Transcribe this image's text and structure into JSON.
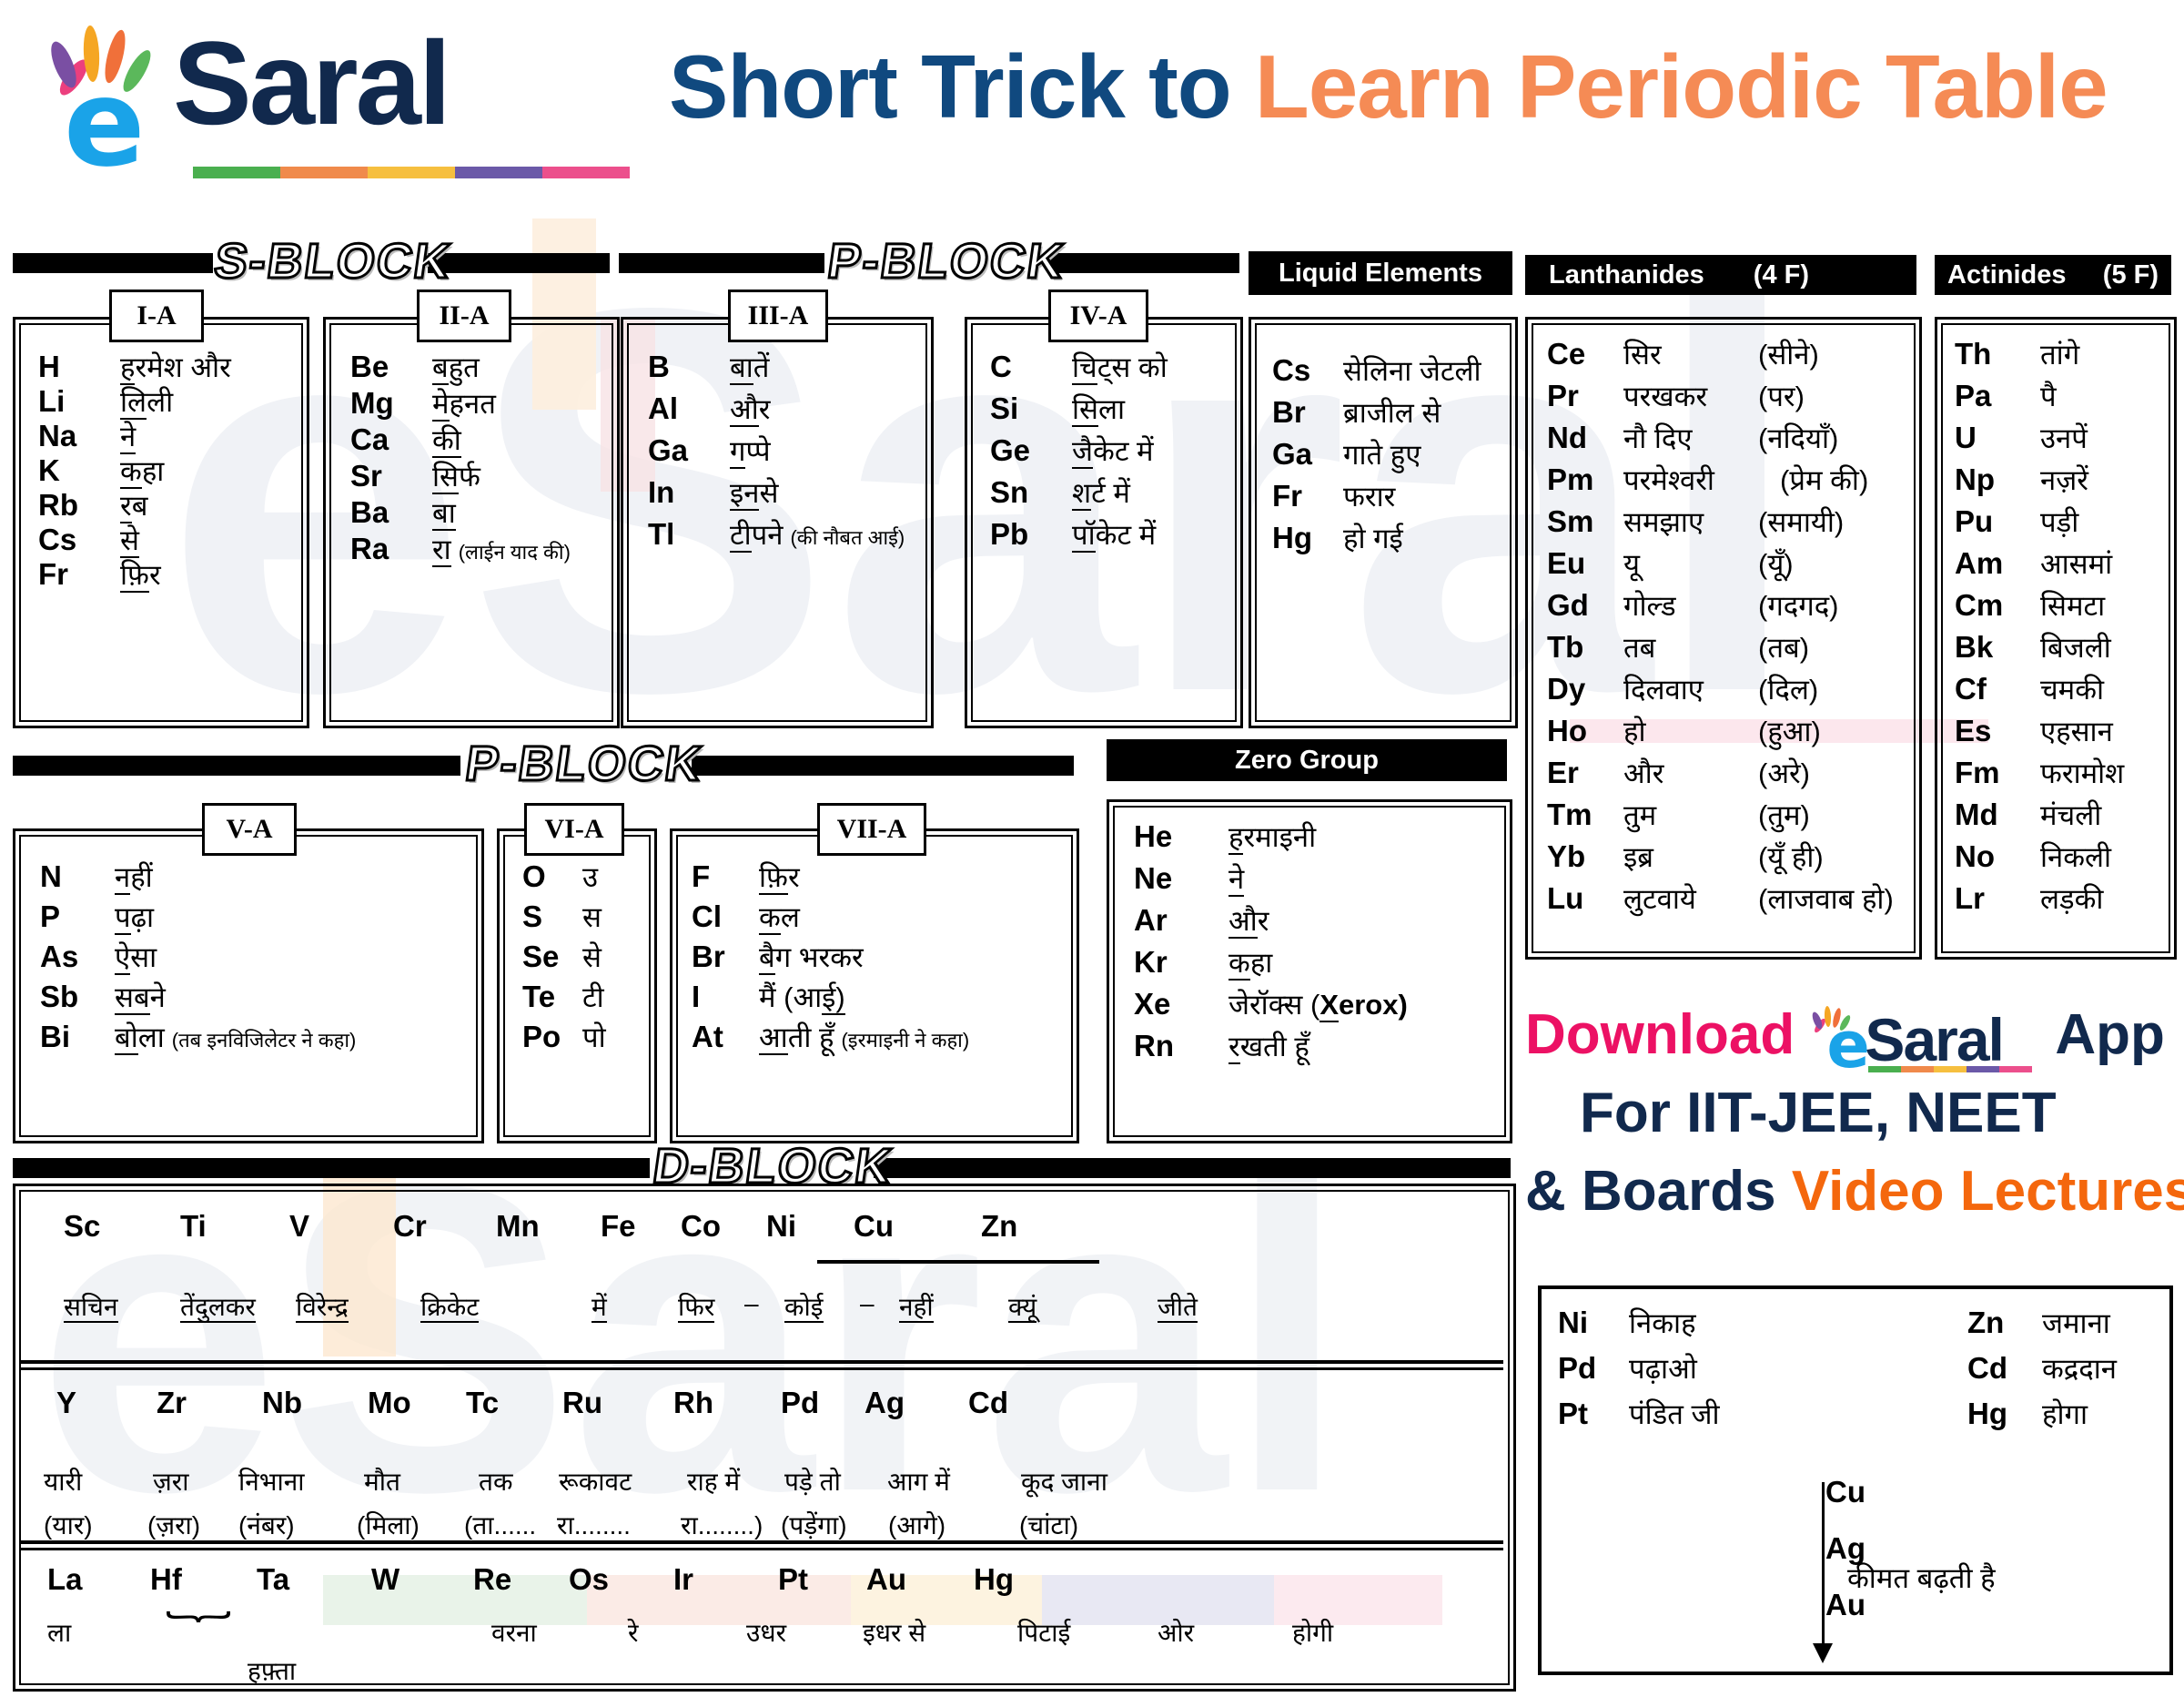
{
  "header": {
    "logo_text": "Saral",
    "logo_e": "e",
    "title_part1": "Short Trick to ",
    "title_part2": "Learn Periodic Table",
    "bar_colors": [
      "#4aaf4f",
      "#f08a4b",
      "#f6bf3f",
      "#6b59a8",
      "#ec4f8c"
    ],
    "hand_colors": [
      "#7a4fa3",
      "#f5a623",
      "#f0703a",
      "#5bb85b",
      "#ec3f7e"
    ],
    "navy": "#11294d",
    "cyan": "#1aa3e8",
    "title_blue": "#10497f",
    "title_orange": "#f58b55"
  },
  "block_labels": {
    "s_block": "S-BLOCK",
    "p_block_1": "P-BLOCK",
    "p_block_2": "P-BLOCK",
    "d_block": "D-BLOCK"
  },
  "groups": [
    {
      "tag": "I-A",
      "rows": [
        {
          "sym": "H",
          "mn": "ह",
          "rest": "रमेश  और"
        },
        {
          "sym": "Li",
          "mn": "लि",
          "rest": "ली"
        },
        {
          "sym": "Na",
          "mn": "ने",
          "rest": ""
        },
        {
          "sym": "K",
          "mn": "क",
          "rest": "हा"
        },
        {
          "sym": "Rb",
          "mn": "र",
          "rest": "ब"
        },
        {
          "sym": "Cs",
          "mn": "से",
          "rest": ""
        },
        {
          "sym": "Fr",
          "mn": "फ़ि",
          "rest": "र"
        }
      ]
    },
    {
      "tag": "II-A",
      "rows": [
        {
          "sym": "Be",
          "mn": "ब",
          "rest": "हुत"
        },
        {
          "sym": "Mg",
          "mn": "मे",
          "rest": "हनत"
        },
        {
          "sym": "Ca",
          "mn": "की",
          "rest": ""
        },
        {
          "sym": "Sr",
          "mn": "सि",
          "rest": "र्फ"
        },
        {
          "sym": "Ba",
          "mn": "बा",
          "rest": ""
        },
        {
          "sym": "Ra",
          "mn": "रा",
          "rest": "",
          "note": "(लाईन याद की)"
        }
      ]
    },
    {
      "tag": "III-A",
      "rows": [
        {
          "sym": "B",
          "mn": "बा",
          "rest": "तें"
        },
        {
          "sym": "Al",
          "mn": "औ",
          "rest": "र"
        },
        {
          "sym": "Ga",
          "mn": "ग",
          "rest": "प्पे"
        },
        {
          "sym": "In",
          "mn": "इन",
          "rest": "से"
        },
        {
          "sym": "Tl",
          "mn": "टी",
          "rest": "पने",
          "note": "(की नौबत आई)"
        }
      ]
    },
    {
      "tag": "IV-A",
      "rows": [
        {
          "sym": "C",
          "mn": "चि",
          "rest": "ट्स  को"
        },
        {
          "sym": "Si",
          "mn": "सि",
          "rest": "ला"
        },
        {
          "sym": "Ge",
          "mn": "जै",
          "rest": "केट  में"
        },
        {
          "sym": "Sn",
          "mn": "श",
          "rest": "र्ट  में"
        },
        {
          "sym": "Pb",
          "mn": "पॉ",
          "rest": "केट  में"
        }
      ]
    },
    {
      "tag": "V-A",
      "rows": [
        {
          "sym": "N",
          "mn": "न",
          "rest": "हीं"
        },
        {
          "sym": "P",
          "mn": "प",
          "rest": "ढ़ा"
        },
        {
          "sym": "As",
          "mn": "ऐ",
          "rest": "सा"
        },
        {
          "sym": "Sb",
          "mn": "सब",
          "rest": "ने"
        },
        {
          "sym": "Bi",
          "mn": "बो",
          "rest": "ला",
          "note": "(तब इनविजिलेटर ने कहा)"
        }
      ]
    },
    {
      "tag": "VI-A",
      "rows": [
        {
          "sym": "O",
          "mn": "उ",
          "rest": ""
        },
        {
          "sym": "S",
          "mn": "स",
          "rest": ""
        },
        {
          "sym": "Se",
          "mn": "से",
          "rest": ""
        },
        {
          "sym": "Te",
          "mn": "टी",
          "rest": ""
        },
        {
          "sym": "Po",
          "mn": "पो",
          "rest": ""
        }
      ]
    },
    {
      "tag": "VII-A",
      "rows": [
        {
          "sym": "F",
          "mn": "फ़ि",
          "rest": "र"
        },
        {
          "sym": "Cl",
          "mn": "क",
          "rest": "ल"
        },
        {
          "sym": "Br",
          "mn": "बै",
          "rest": "ग  भरकर"
        },
        {
          "sym": "I",
          "mn": "मैं  (आ",
          "rest": "ई)"
        },
        {
          "sym": "At",
          "mn": "आ",
          "rest": "ती हूँ",
          "note": "(इरमाइनी ने कहा)"
        }
      ]
    }
  ],
  "liquid_elements": {
    "title": "Liquid Elements",
    "rows": [
      {
        "sym": "Cs",
        "mn": "सेलिना  जेटली"
      },
      {
        "sym": "Br",
        "mn": "ब्राजील  से"
      },
      {
        "sym": "Ga",
        "mn": "गाते  हुए"
      },
      {
        "sym": "Fr",
        "mn": "फरार"
      },
      {
        "sym": "Hg",
        "mn": "हो  गई"
      }
    ]
  },
  "zero_group": {
    "title": "Zero Group",
    "rows": [
      {
        "sym": "He",
        "mn": "ह",
        "rest": "रमाइनी"
      },
      {
        "sym": "Ne",
        "mn": "ने",
        "rest": ""
      },
      {
        "sym": "Ar",
        "mn": "औ",
        "rest": "र"
      },
      {
        "sym": "Kr",
        "mn": "क",
        "rest": "हा"
      },
      {
        "sym": "Xe",
        "mn": "जेरॉक्स (",
        "rest": "Xerox)",
        "bold_tail": true
      },
      {
        "sym": "Rn",
        "mn": "र",
        "rest": "खती  हूँ"
      }
    ]
  },
  "lanthanides": {
    "title": "Lanthanides",
    "sub": "(4 F)",
    "rows": [
      {
        "sym": "Ce",
        "mn": "सिर",
        "par": "(सीने)"
      },
      {
        "sym": "Pr",
        "mn": "परखकर",
        "par": "(पर)"
      },
      {
        "sym": "Nd",
        "mn": "नौ दिए",
        "par": "(नदियाँ)"
      },
      {
        "sym": "Pm",
        "mn": "परमेश्वरी",
        "par": "(प्रेम की)"
      },
      {
        "sym": "Sm",
        "mn": "समझाए",
        "par": "(समायी)"
      },
      {
        "sym": "Eu",
        "mn": "यू",
        "par": "(यूँ)"
      },
      {
        "sym": "Gd",
        "mn": "गोल्ड",
        "par": "(गदगद)"
      },
      {
        "sym": "Tb",
        "mn": "तब",
        "par": "(तब)"
      },
      {
        "sym": "Dy",
        "mn": "दिलवाए",
        "par": "(दिल)"
      },
      {
        "sym": "Ho",
        "mn": "हो",
        "par": "(हुआ)"
      },
      {
        "sym": "Er",
        "mn": "और",
        "par": "(अरे)"
      },
      {
        "sym": "Tm",
        "mn": "तुम",
        "par": "(तुम)"
      },
      {
        "sym": "Yb",
        "mn": "इब्र",
        "par": "(यूँ ही)"
      },
      {
        "sym": "Lu",
        "mn": "लुटवाये",
        "par": "(लाजवाब हो)"
      }
    ]
  },
  "actinides": {
    "title": "Actinides",
    "sub": "(5 F)",
    "rows": [
      {
        "sym": "Th",
        "mn": "तांगे"
      },
      {
        "sym": "Pa",
        "mn": "पै"
      },
      {
        "sym": "U",
        "mn": "उनपें"
      },
      {
        "sym": "Np",
        "mn": "नज़रें"
      },
      {
        "sym": "Pu",
        "mn": "पड़ी"
      },
      {
        "sym": "Am",
        "mn": "आसमां"
      },
      {
        "sym": "Cm",
        "mn": "सिमटा"
      },
      {
        "sym": "Bk",
        "mn": "बिजली"
      },
      {
        "sym": "Cf",
        "mn": "चमकी"
      },
      {
        "sym": "Es",
        "mn": "एहसान"
      },
      {
        "sym": "Fm",
        "mn": "फरामोश"
      },
      {
        "sym": "Md",
        "mn": "मंचली"
      },
      {
        "sym": "No",
        "mn": "निकली"
      },
      {
        "sym": "Lr",
        "mn": "लड़की"
      }
    ]
  },
  "d_block": {
    "row1": {
      "symbols": [
        "Sc",
        "Ti",
        "V",
        "Cr",
        "Mn",
        "Fe",
        "Co",
        "Ni",
        "Cu",
        "Zn"
      ],
      "words": [
        "सचिन",
        "तेंदुलकर",
        "विरेन्द्र",
        "क्रिकेट",
        "में",
        "फिर",
        "–",
        "कोई",
        "–",
        "नहीं",
        "क्यूं",
        "जीते"
      ]
    },
    "row2": {
      "symbols": [
        "Y",
        "Zr",
        "Nb",
        "Mo",
        "Tc",
        "Ru",
        "Rh",
        "Pd",
        "Ag",
        "Cd"
      ],
      "words": [
        "यारी",
        "ज़रा",
        "निभाना",
        "मौत",
        "तक",
        "रूकावट",
        "राह में",
        "पड़े तो",
        "आग में",
        "कूद जाना"
      ],
      "words2": [
        "(यार)",
        "(ज़रा)",
        "(नंबर)",
        "(मिला)",
        "(ता......",
        "रा........",
        "रा........)",
        "(पड़ेंगा)",
        "(आगे)",
        "(चांटा)"
      ]
    },
    "row3": {
      "symbols": [
        "La",
        "Hf",
        "Ta",
        "W",
        "Re",
        "Os",
        "Ir",
        "Pt",
        "Au",
        "Hg"
      ],
      "words": [
        "ला",
        "",
        "",
        "",
        "वरना",
        "रे",
        "उधर",
        "इधर से",
        "पिटाई",
        "ओर",
        "होगी"
      ],
      "brace_label": "हफ़्ता"
    }
  },
  "promo": {
    "line1_a": "Download ",
    "line1_logo_e": "e",
    "line1_logo_saral": "Saral",
    "line1_b": " App",
    "line2": "For IIT-JEE, NEET",
    "line3_a": "& Boards ",
    "line3_b": "Video Lectures"
  },
  "bottom_box": {
    "left": [
      {
        "sym": "Ni",
        "mn": "निकाह"
      },
      {
        "sym": "Pd",
        "mn": "पढ़ाओ"
      },
      {
        "sym": "Pt",
        "mn": "पंडित जी"
      }
    ],
    "right": [
      {
        "sym": "Zn",
        "mn": "जमाना"
      },
      {
        "sym": "Cd",
        "mn": "कद्रदान"
      },
      {
        "sym": "Hg",
        "mn": "होगा"
      }
    ],
    "series": [
      "Cu",
      "Ag",
      "Au"
    ],
    "arrow_label": "कीमत बढ़ती है"
  }
}
